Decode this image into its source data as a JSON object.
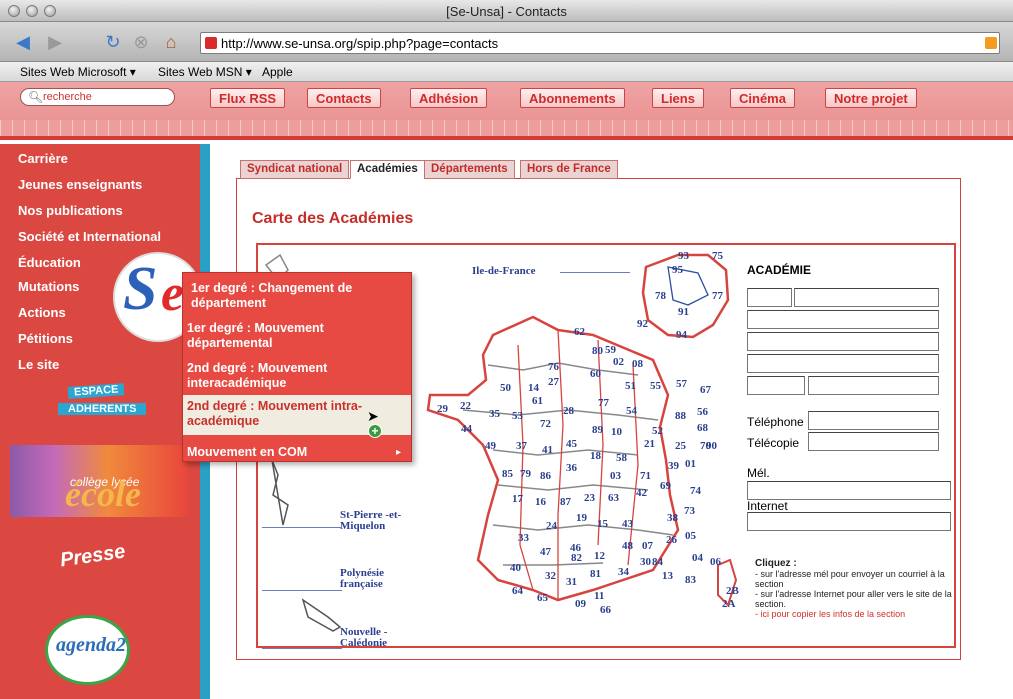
{
  "window": {
    "title": "[Se-Unsa] - Contacts"
  },
  "browser": {
    "url": "http://www.se-unsa.org/spip.php?page=contacts",
    "bookmarks": [
      "Sites Web Microsoft ▾",
      "Sites Web MSN ▾",
      "Apple"
    ]
  },
  "header": {
    "search_placeholder": "recherche",
    "nav": [
      "Flux RSS",
      "Contacts",
      "Adhésion",
      "Abonnements",
      "Liens",
      "Cinéma",
      "Notre projet"
    ]
  },
  "sidebar": {
    "items": [
      "Carrière",
      "Jeunes enseignants",
      "Nos publications",
      "Société et International",
      "Éducation",
      "Mutations",
      "Actions",
      "Pétitions",
      "Le site"
    ],
    "espace_line1": "ESPACE",
    "espace_line2": "ADHERENTS",
    "presse": "Presse",
    "agenda": "agenda21",
    "college_big": "école",
    "college_small": "collège lycée"
  },
  "dropdown": {
    "items": [
      "1er degré : Changement de département",
      "1er degré : Mouvement départemental",
      "2nd degré : Mouvement interacadémique",
      "2nd degré : Mouvement intra-académique",
      "Mouvement en COM"
    ]
  },
  "content": {
    "tabs": [
      "Syndicat national",
      "Académies",
      "Départements",
      "Hors de France"
    ],
    "active_tab": "Académies",
    "title": "Carte des Académies"
  },
  "map": {
    "ile_de_france": "Ile-de-France",
    "st_pierre": "St-Pierre -et-Miquelon",
    "polynesie": "Polynésie française",
    "nouvelle_caledonie": "Nouvelle -Calédonie",
    "idf_numbers": [
      "93",
      "75",
      "95",
      "78",
      "77",
      "91",
      "92",
      "94"
    ],
    "dept_numbers": [
      "59",
      "62",
      "80",
      "02",
      "08",
      "76",
      "60",
      "14",
      "27",
      "50",
      "61",
      "51",
      "55",
      "57",
      "67",
      "29",
      "22",
      "35",
      "53",
      "72",
      "28",
      "77",
      "54",
      "88",
      "56",
      "44",
      "49",
      "37",
      "41",
      "45",
      "89",
      "10",
      "52",
      "68",
      "70",
      "25",
      "90",
      "85",
      "79",
      "86",
      "36",
      "18",
      "58",
      "21",
      "39",
      "71",
      "17",
      "16",
      "87",
      "23",
      "03",
      "63",
      "42",
      "69",
      "01",
      "74",
      "73",
      "33",
      "24",
      "19",
      "15",
      "43",
      "38",
      "40",
      "47",
      "46",
      "12",
      "48",
      "07",
      "26",
      "05",
      "04",
      "06",
      "64",
      "65",
      "32",
      "31",
      "81",
      "30",
      "84",
      "13",
      "83",
      "82",
      "34",
      "11",
      "09",
      "66",
      "2B",
      "2A"
    ]
  },
  "form": {
    "academie": "ACADÉMIE",
    "telephone": "Téléphone",
    "telecopie": "Télécopie",
    "mel": "Mél.",
    "internet": "Internet"
  },
  "instructions": {
    "heading": "Cliquez :",
    "line1": "- sur l'adresse mél pour envoyer un courriel à la section",
    "line2": "- sur l'adresse Internet pour aller vers le site de la section.",
    "line3": "- ici pour copier les infos de la section"
  }
}
